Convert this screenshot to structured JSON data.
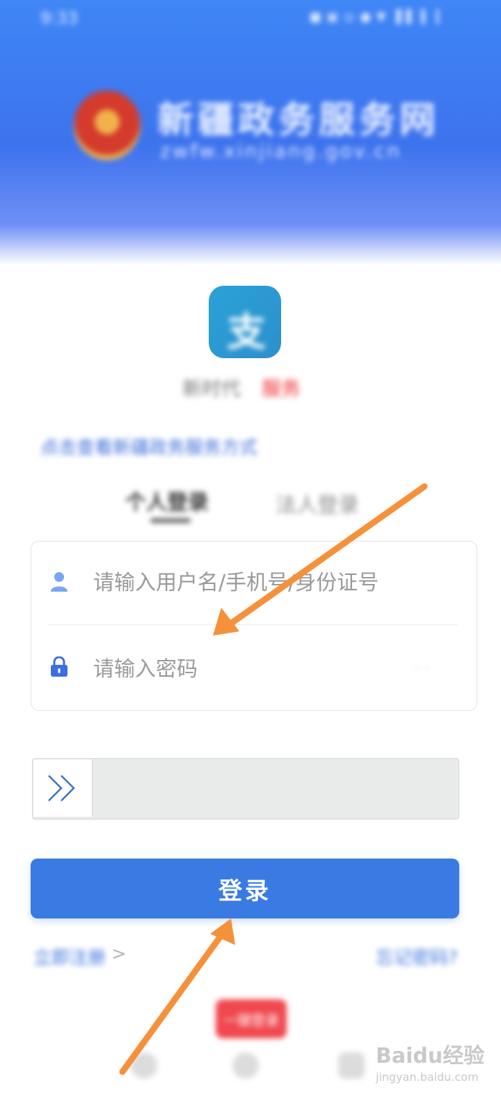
{
  "status_bar": {
    "time": "9:33",
    "indicators": "■ ▣ ◎ ● ▼ ▐ ▌ ▍ ▎"
  },
  "header": {
    "emblem_icon": "national-emblem",
    "title": "新疆政务服务网",
    "url": "zwfw.xinjiang.gov.cn"
  },
  "app": {
    "icon": "app-logo-icon",
    "icon_glyph": "支",
    "name_part1": "新时代",
    "name_part2": "服务"
  },
  "notice_link": "点击查看新疆政务服务方式",
  "tabs": [
    {
      "label": "个人登录",
      "active": true
    },
    {
      "label": "法人登录",
      "active": false
    }
  ],
  "form": {
    "username_placeholder": "请输入用户名/手机号/身份证号",
    "password_placeholder": "请输入密码",
    "username_value": "",
    "password_value": "",
    "eye_toggle": "- -",
    "user_icon": "user-icon",
    "lock_icon": "lock-icon"
  },
  "slider": {
    "handle_icon": "double-chevron-right-icon",
    "progress": 0
  },
  "login_button": "登录",
  "links": {
    "register": "立即注册",
    "register_chevron": ">",
    "forgot": "忘记密码?"
  },
  "bottom_badge": "一键登录",
  "colors": {
    "header_blue": "#3f86f6",
    "primary": "#3a7be3",
    "arrow": "#f5913a",
    "danger": "#f0484f"
  },
  "watermark": {
    "logo": "Baidu经验",
    "url": "jingyan.baidu.com"
  }
}
